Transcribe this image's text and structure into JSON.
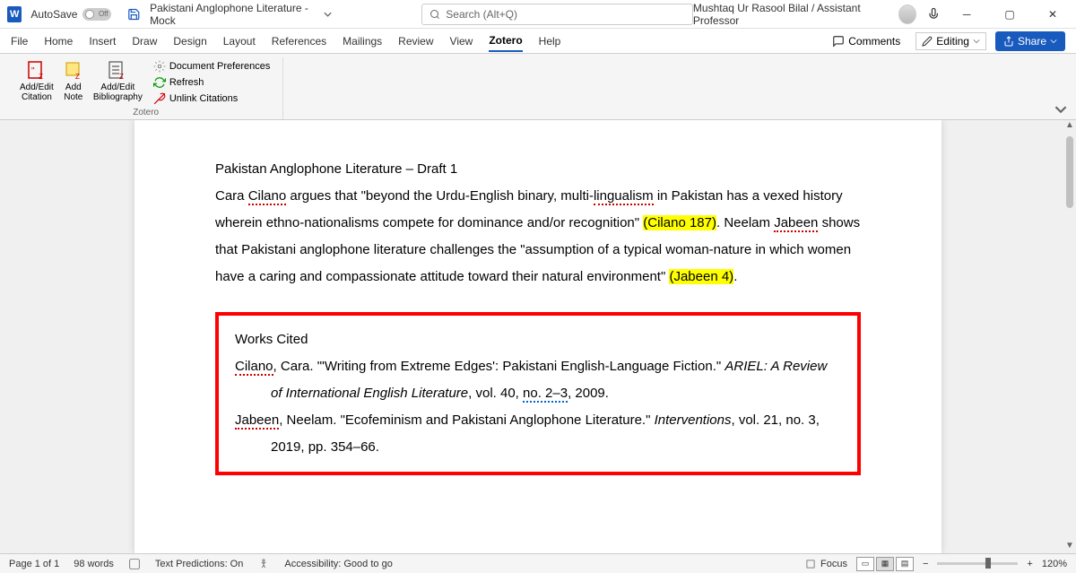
{
  "titlebar": {
    "autosave_label": "AutoSave",
    "autosave_state": "Off",
    "doc_title": "Pakistani Anglophone Literature - Mock",
    "search_placeholder": "Search (Alt+Q)",
    "user_name": "Mushtaq Ur Rasool Bilal / Assistant Professor"
  },
  "tabs": {
    "items": [
      "File",
      "Home",
      "Insert",
      "Draw",
      "Design",
      "Layout",
      "References",
      "Mailings",
      "Review",
      "View",
      "Zotero",
      "Help"
    ],
    "active": "Zotero",
    "comments": "Comments",
    "editing": "Editing",
    "share": "Share"
  },
  "ribbon": {
    "add_edit_citation": "Add/Edit\nCitation",
    "add_note": "Add\nNote",
    "add_edit_bibliography": "Add/Edit\nBibliography",
    "doc_prefs": "Document Preferences",
    "refresh": "Refresh",
    "unlink": "Unlink Citations",
    "group": "Zotero"
  },
  "document": {
    "heading": "Pakistan Anglophone Literature – Draft 1",
    "para1_a": "Cara ",
    "para1_cilano": "Cilano",
    "para1_b": " argues that \"beyond the Urdu-English binary, multi-",
    "para1_lingualism": "lingualism",
    "para1_c": " in Pakistan has a vexed history wherein ethno-nationalisms compete for dominance and/or recognition\" ",
    "cite1": "(Cilano 187)",
    "para1_d": ". Neelam ",
    "para1_jabeen": "Jabeen",
    "para1_e": " shows that Pakistani anglophone literature challenges the \"assumption of a typical woman-nature in which women have a caring and compassionate attitude toward their natural environment\" ",
    "cite2": "(Jabeen 4)",
    "para1_f": ".",
    "works_cited": "Works Cited",
    "ref1_a": "Cilano",
    "ref1_b": ", Cara. \"'Writing from Extreme Edges': Pakistani English-Language Fiction.\" ",
    "ref1_journal": "ARIEL: A Review of International English Literature",
    "ref1_c": ", vol. 40, ",
    "ref1_no": "no. 2–3",
    "ref1_d": ", 2009.",
    "ref2_a": "Jabeen",
    "ref2_b": ", Neelam. \"Ecofeminism and Pakistani Anglophone Literature.\" ",
    "ref2_journal": "Interventions",
    "ref2_c": ", vol. 21, no. 3, 2019, pp. 354–66."
  },
  "statusbar": {
    "page": "Page 1 of 1",
    "words": "98 words",
    "predictions": "Text Predictions: On",
    "accessibility": "Accessibility: Good to go",
    "focus": "Focus",
    "zoom": "120%"
  }
}
